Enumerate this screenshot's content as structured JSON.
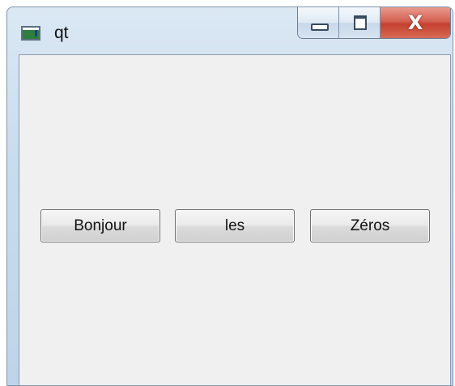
{
  "window": {
    "title": "qt",
    "close_glyph": "X",
    "icons": [
      "app-icon",
      "minimize-icon",
      "maximize-icon",
      "close-icon"
    ]
  },
  "buttons": [
    {
      "label": "Bonjour"
    },
    {
      "label": "les"
    },
    {
      "label": "Zéros"
    }
  ]
}
